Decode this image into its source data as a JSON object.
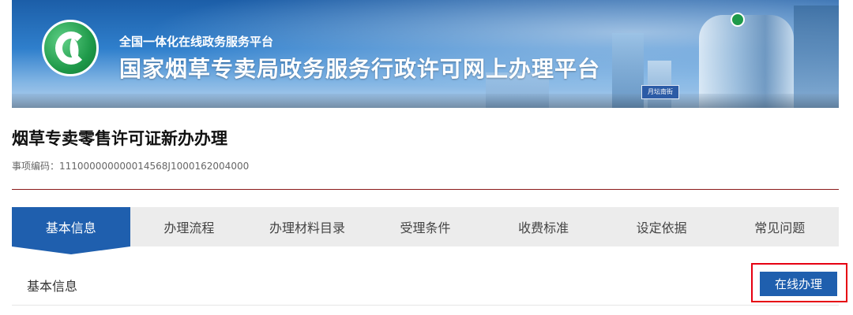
{
  "banner": {
    "subtitle": "全国一体化在线政务服务平台",
    "title": "国家烟草专卖局政务服务行政许可网上办理平台",
    "road_sign": "月坛南街"
  },
  "item": {
    "title": "烟草专卖零售许可证新办办理",
    "code_line": "事项编码：111000000000014568J1000162004000"
  },
  "tabs": [
    {
      "label": "基本信息",
      "active": true
    },
    {
      "label": "办理流程",
      "active": false
    },
    {
      "label": "办理材料目录",
      "active": false
    },
    {
      "label": "受理条件",
      "active": false
    },
    {
      "label": "收费标准",
      "active": false
    },
    {
      "label": "设定依据",
      "active": false
    },
    {
      "label": "常见问题",
      "active": false
    }
  ],
  "section": {
    "title": "基本信息",
    "online_button": "在线办理"
  },
  "colors": {
    "primary": "#1f5fae",
    "divider": "#8b1a1a",
    "highlight": "#e60012",
    "tab_bg": "#ececec"
  }
}
